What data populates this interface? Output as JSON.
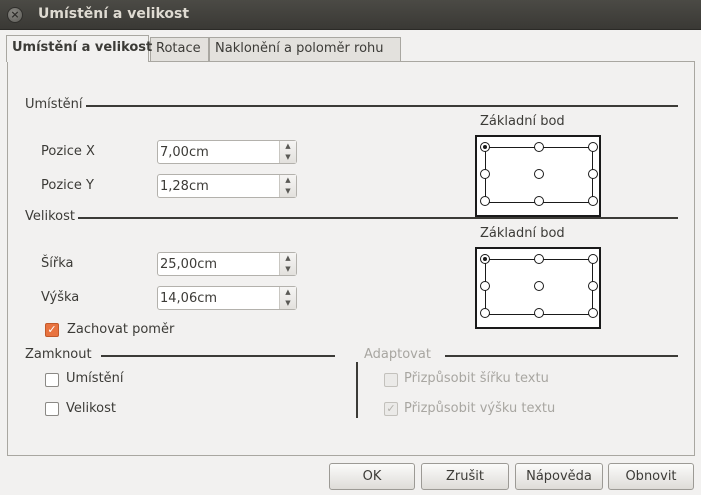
{
  "window": {
    "title": "Umístění a velikost",
    "close_glyph": "×"
  },
  "tabs": [
    {
      "label": "Umístění a velikost",
      "active": true
    },
    {
      "label": "Rotace",
      "active": false
    },
    {
      "label": "Naklonění a poloměr rohu",
      "active": false
    }
  ],
  "position": {
    "section_label": "Umístění",
    "x_label": "Pozice X",
    "x_value": "7,00cm",
    "y_label": "Pozice Y",
    "y_value": "1,28cm",
    "base_point_label": "Základní bod",
    "base_point_selected": "top-left"
  },
  "size": {
    "section_label": "Velikost",
    "width_label": "Šířka",
    "width_value": "25,00cm",
    "height_label": "Výška",
    "height_value": "14,06cm",
    "base_point_label": "Základní bod",
    "base_point_selected": "top-left",
    "keep_ratio_label": "Zachovat poměr",
    "keep_ratio_checked": true
  },
  "protect": {
    "section_label": "Zamknout",
    "position_label": "Umístění",
    "position_checked": false,
    "size_label": "Velikost",
    "size_checked": false
  },
  "adapt": {
    "section_label": "Adaptovat",
    "fit_width_label": "Přizpůsobit šířku textu",
    "fit_width_checked": false,
    "fit_height_label": "Přizpůsobit výšku textu",
    "fit_height_checked": true,
    "enabled": false
  },
  "buttons": {
    "ok": "OK",
    "cancel": "Zrušit",
    "help": "Nápověda",
    "reset": "Obnovit"
  },
  "colors": {
    "accent_checkbox": "#e8733f",
    "titlebar": "#3c3b37"
  }
}
